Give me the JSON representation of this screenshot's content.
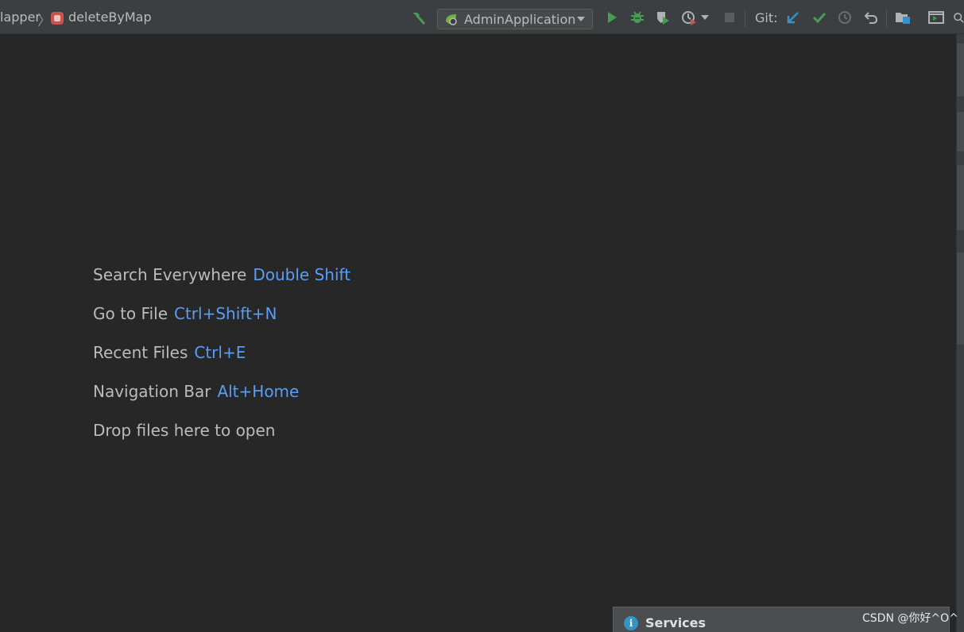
{
  "breadcrumb": {
    "first": "lapper",
    "second": "deleteByMap"
  },
  "toolbar": {
    "run_config": "AdminApplication",
    "git_label": "Git:"
  },
  "hints": [
    {
      "label": "Search Everywhere",
      "key": "Double Shift"
    },
    {
      "label": "Go to File",
      "key": "Ctrl+Shift+N"
    },
    {
      "label": "Recent Files",
      "key": "Ctrl+E"
    },
    {
      "label": "Navigation Bar",
      "key": "Alt+Home"
    },
    {
      "label": "Drop files here to open",
      "key": ""
    }
  ],
  "services_panel": {
    "title": "Services"
  },
  "watermark": "CSDN @你好^O^",
  "colors": {
    "background": "#272727",
    "toolbar": "#3c3f41",
    "shortcut_accent": "#589df6",
    "run_green": "#499c54",
    "git_blue": "#3592c4"
  }
}
